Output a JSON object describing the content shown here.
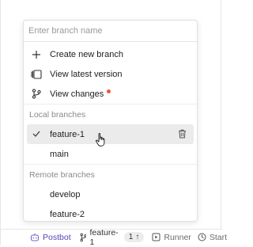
{
  "search": {
    "placeholder": "Enter branch name"
  },
  "actions": [
    {
      "label": "Create new branch",
      "icon": "plus-icon"
    },
    {
      "label": "View latest version",
      "icon": "version-icon"
    },
    {
      "label": "View changes",
      "icon": "git-compare-icon",
      "has_dot": true
    }
  ],
  "local_section": {
    "label": "Local branches"
  },
  "local_branches": [
    {
      "label": "feature-1",
      "checked": true,
      "hovered": true
    },
    {
      "label": "main",
      "checked": false
    }
  ],
  "remote_section": {
    "label": "Remote branches"
  },
  "remote_branches": [
    {
      "label": "develop"
    },
    {
      "label": "feature-2"
    }
  ],
  "statusbar": {
    "postbot_label": "Postbot",
    "branch_label": "feature-1",
    "sync_count": "1",
    "sync_arrow": "↑",
    "runner_label": "Runner",
    "start_label": "Start"
  },
  "colors": {
    "accent_postbot": "#7b5fd6",
    "notification_dot": "#eb5a3c",
    "hover_bg": "#ebebeb"
  }
}
